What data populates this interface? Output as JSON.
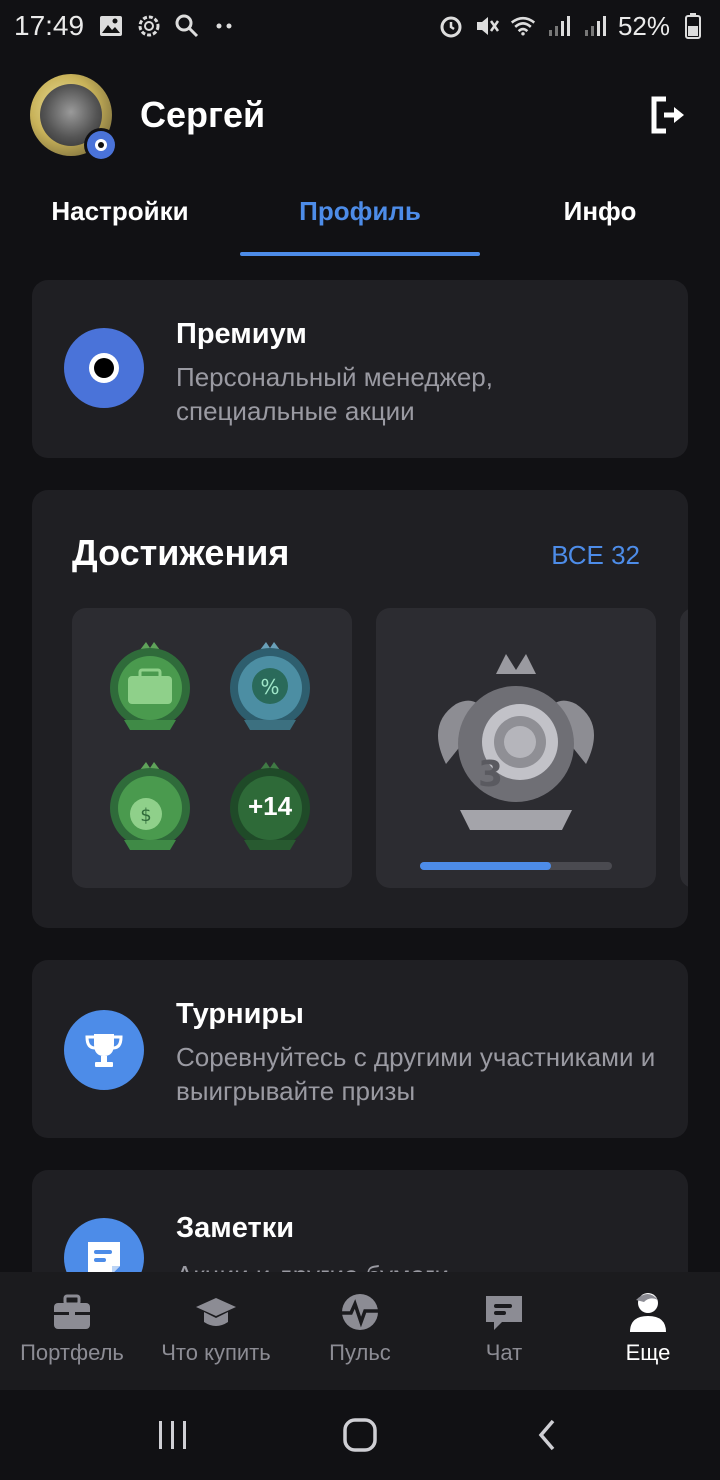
{
  "status_bar": {
    "time": "17:49",
    "battery": "52%"
  },
  "header": {
    "user_name": "Сергей"
  },
  "tabs": [
    {
      "label": "Настройки",
      "active": false
    },
    {
      "label": "Профиль",
      "active": true
    },
    {
      "label": "Инфо",
      "active": false
    }
  ],
  "premium": {
    "title": "Премиум",
    "subtitle": "Персональный менеджер, специальные акции"
  },
  "achievements": {
    "title": "Достижения",
    "all_link": "ВСЕ 32",
    "more_count": "+14",
    "progress_fraction": 0.68
  },
  "tournaments": {
    "title": "Турниры",
    "subtitle": "Соревнуйтесь с другими участниками и выигрывайте призы"
  },
  "notes": {
    "title": "Заметки",
    "subtitle": "Акции и другие бумаги"
  },
  "bottom_nav": [
    {
      "label": "Портфель",
      "icon": "briefcase-icon",
      "active": false
    },
    {
      "label": "Что купить",
      "icon": "graduation-cap-icon",
      "active": false
    },
    {
      "label": "Пульс",
      "icon": "pulse-icon",
      "active": false
    },
    {
      "label": "Чат",
      "icon": "chat-icon",
      "active": false
    },
    {
      "label": "Еще",
      "icon": "person-icon",
      "active": true
    }
  ],
  "colors": {
    "accent": "#4d8ce8",
    "premium": "#4a73d9",
    "card": "#1f1f23",
    "background": "#111114"
  }
}
